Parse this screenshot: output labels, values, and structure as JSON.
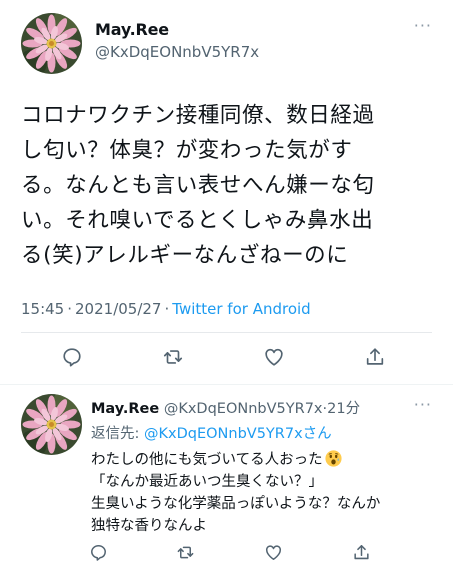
{
  "tweet": {
    "display_name": "May.Ree",
    "handle": "@KxDqEONnbV5YR7x",
    "more": "···",
    "text": "コロナワクチン接種同僚、数日経過\nし匂い？体臭？が変わった気がす\nる。なんとも言い表せへん嫌ーな匂\nい。それ嗅いでるとくしゃみ鼻水出\nる(笑)アレルギーなんざねーのに",
    "time": "15:45",
    "date": "2021/05/27",
    "separator": "·",
    "source": "Twitter for Android",
    "icons": [
      "reply-icon",
      "retweet-icon",
      "like-icon",
      "share-icon"
    ]
  },
  "reply": {
    "display_name": "May.Ree",
    "handle": "@KxDqEONnbV5YR7x",
    "age": "21分",
    "separator": "·",
    "more": "···",
    "replying_label": "返信先: ",
    "replying_to": "@KxDqEONnbV5YR7xさん",
    "text_line1": "わたしの他にも気づいてる人おった",
    "emoji": "astonished-face-emoji",
    "text_rest": "「なんか最近あいつ生臭くない？」\n生臭いような化学薬品っぽいような？なんか\n独特な香りなんよ",
    "icons": [
      "reply-icon",
      "retweet-icon",
      "like-icon",
      "share-icon"
    ]
  },
  "colors": {
    "text": "#0f1419",
    "secondary": "#536471",
    "link": "#1d9bf0",
    "divider": "#eff3f4"
  }
}
